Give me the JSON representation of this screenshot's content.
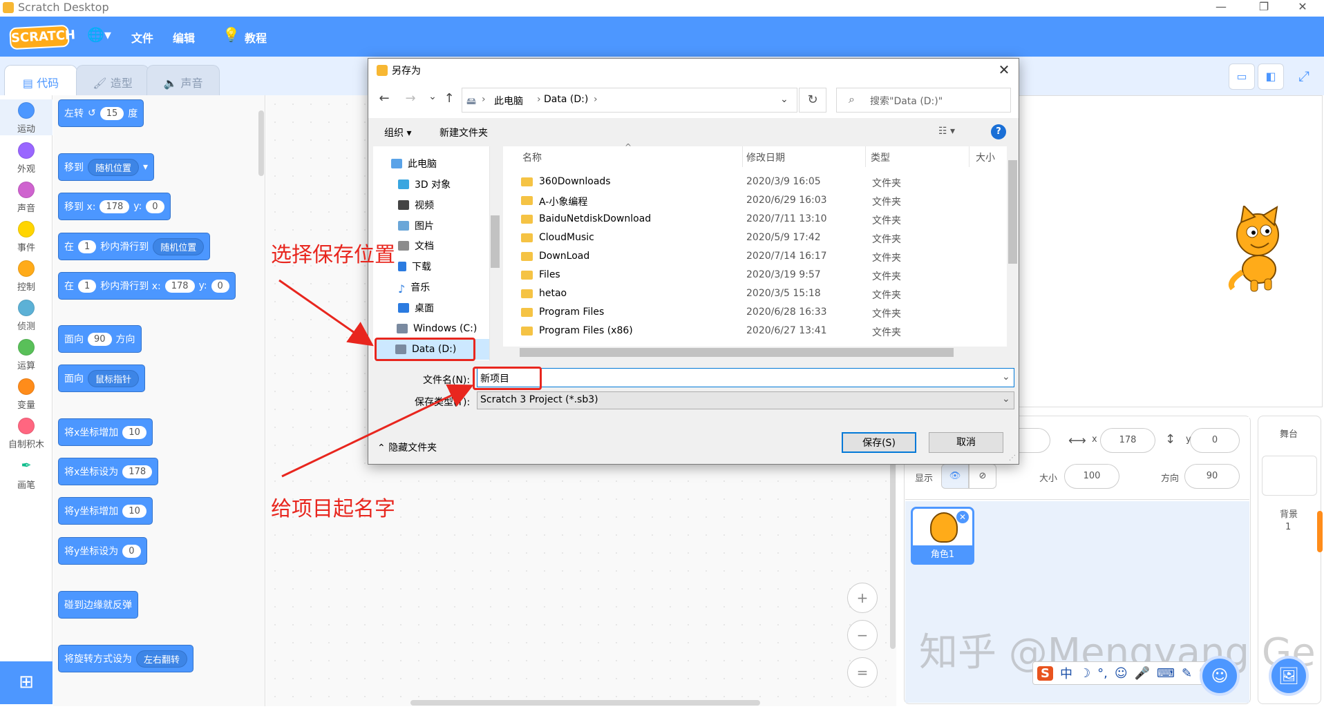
{
  "window": {
    "title": "Scratch Desktop",
    "controls": [
      "—",
      "❐",
      "✕"
    ]
  },
  "menubar": {
    "logo": "SCRATCH",
    "globe": "🌐▾",
    "file": "文件",
    "edit": "编辑",
    "tutorial": "教程"
  },
  "tabs": {
    "code": "代码",
    "costume": "造型",
    "sound": "声音"
  },
  "categories": [
    {
      "label": "运动",
      "color": "#4c97ff"
    },
    {
      "label": "外观",
      "color": "#9966ff"
    },
    {
      "label": "声音",
      "color": "#cf63cf"
    },
    {
      "label": "事件",
      "color": "#ffd500"
    },
    {
      "label": "控制",
      "color": "#ffab19"
    },
    {
      "label": "侦测",
      "color": "#5cb1d6"
    },
    {
      "label": "运算",
      "color": "#59c059"
    },
    {
      "label": "变量",
      "color": "#ff8c1a"
    },
    {
      "label": "自制积木",
      "color": "#ff6680"
    },
    {
      "label": "画笔",
      "color": "#0fbd8c"
    }
  ],
  "blocks": {
    "turn_left": "左转",
    "turn_value": "15",
    "degrees": "度",
    "goto": "移到",
    "random_pos": "随机位置",
    "goto_xy": "移到 x:",
    "x_val": "178",
    "y_label": "y:",
    "y_val": "0",
    "glide_in": "在",
    "glide_secs": "1",
    "glide_to": "秒内滑行到",
    "glide_to_xy": "秒内滑行到 x:",
    "point_dir": "面向",
    "dir_val": "90",
    "direction": "方向",
    "point_towards": "面向",
    "mouse_pointer": "鼠标指针",
    "change_x": "将x坐标增加",
    "change_val": "10",
    "set_x": "将x坐标设为",
    "change_y": "将y坐标增加",
    "set_y": "将y坐标设为",
    "bounce": "碰到边缘就反弹",
    "rotation_style": "将旋转方式设为",
    "left_right": "左右翻转"
  },
  "dialog": {
    "title": "另存为",
    "back": "←",
    "forward": "→",
    "recent": "⌄",
    "up": "↑",
    "breadcrumb": [
      "此电脑",
      "Data (D:)"
    ],
    "refresh": "↻",
    "search_placeholder": "搜索\"Data (D:)\"",
    "organize": "组织 ▾",
    "new_folder": "新建文件夹",
    "view": "☷ ▾",
    "help": "?",
    "nav_items": [
      {
        "label": "此电脑",
        "color": "#5aa3e8"
      },
      {
        "label": "3D 对象",
        "color": "#39a6e0"
      },
      {
        "label": "视频",
        "color": "#444444"
      },
      {
        "label": "图片",
        "color": "#6aa6d8"
      },
      {
        "label": "文档",
        "color": "#8c8c8c"
      },
      {
        "label": "下载",
        "color": "#2b7be0"
      },
      {
        "label": "音乐",
        "color": "#2b7be0"
      },
      {
        "label": "桌面",
        "color": "#2b7be0"
      },
      {
        "label": "Windows (C:)",
        "color": "#7a8aa0"
      },
      {
        "label": "Data (D:)",
        "color": "#7a8aa0"
      }
    ],
    "columns": {
      "name": "名称",
      "date": "修改日期",
      "type": "类型",
      "size": "大小"
    },
    "files": [
      {
        "name": "360Downloads",
        "date": "2020/3/9 16:05",
        "type": "文件夹"
      },
      {
        "name": "A-小象编程",
        "date": "2020/6/29 16:03",
        "type": "文件夹"
      },
      {
        "name": "BaiduNetdiskDownload",
        "date": "2020/7/11 13:10",
        "type": "文件夹"
      },
      {
        "name": "CloudMusic",
        "date": "2020/5/9 17:42",
        "type": "文件夹"
      },
      {
        "name": "DownLoad",
        "date": "2020/7/14 16:17",
        "type": "文件夹"
      },
      {
        "name": "Files",
        "date": "2020/3/19 9:57",
        "type": "文件夹"
      },
      {
        "name": "hetao",
        "date": "2020/3/5 15:18",
        "type": "文件夹"
      },
      {
        "name": "Program Files",
        "date": "2020/6/28 16:33",
        "type": "文件夹"
      },
      {
        "name": "Program Files (x86)",
        "date": "2020/6/27 13:41",
        "type": "文件夹"
      }
    ],
    "filename_label": "文件名(N):",
    "filename_value": "新项目",
    "filetype_label": "保存类型(T):",
    "filetype_value": "Scratch 3 Project (*.sb3)",
    "hide_folders": "隐藏文件夹",
    "save": "保存(S)",
    "cancel": "取消"
  },
  "annotations": {
    "choose_location": "选择保存位置",
    "name_project": "给项目起名字"
  },
  "sprite_info": {
    "x_label": "x",
    "x_val": "178",
    "y_label": "y",
    "y_val": "0",
    "show_label": "显示",
    "size_label": "大小",
    "size_val": "100",
    "direction_label": "方向",
    "direction_val": "90",
    "sprite_name": "角色1"
  },
  "stage_panel": {
    "title": "舞台",
    "backdrop_label": "背景",
    "backdrop_count": "1"
  },
  "zoom": {
    "in": "+",
    "out": "−",
    "reset": "="
  },
  "watermark": "知乎 @Mengyang Ge",
  "ime": {
    "logo": "S",
    "items": [
      "中",
      "☽",
      "°,",
      "☺",
      "🎤",
      "⌨",
      "✎",
      "🔍",
      "⊞"
    ]
  }
}
